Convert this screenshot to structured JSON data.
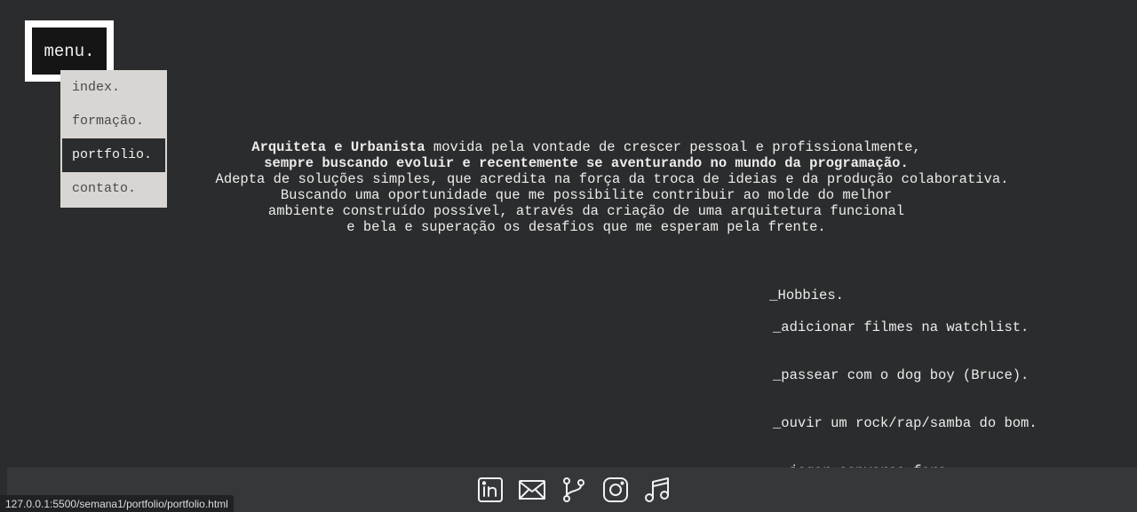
{
  "menu": {
    "label": "menu.",
    "items": [
      {
        "label": "index."
      },
      {
        "label": "formação."
      },
      {
        "label": "portfolio."
      },
      {
        "label": "contato."
      }
    ]
  },
  "intro": {
    "line1_bold": "Arquiteta e Urbanista",
    "line1_rest": " movida pela vontade de crescer pessoal e profissionalmente,",
    "line2": "sempre buscando evoluir e recentemente se aventurando no mundo da programação.",
    "line3": "Adepta de soluções simples, que acredita na força da troca de ideias e da produção colaborativa.",
    "line4": "Buscando uma oportunidade que me possibilite contribuir ao molde do melhor",
    "line5": "ambiente construído possível, através da criação de uma arquitetura funcional",
    "line6": "e bela e superação os desafios que me esperam pela frente."
  },
  "hobbies": {
    "title": "_Hobbies.",
    "items": [
      "_adicionar filmes na watchlist.",
      "_passear com o dog boy (Bruce).",
      "_ouvir um rock/rap/samba do bom.",
      " _jogar conversa fora."
    ]
  },
  "footer": {
    "icons": [
      "linkedin-icon",
      "mail-icon",
      "git-branch-icon",
      "instagram-icon",
      "music-icon"
    ]
  },
  "status_bar": {
    "url": "127.0.0.1:5500/semana1/portfolio/portfolio.html"
  }
}
